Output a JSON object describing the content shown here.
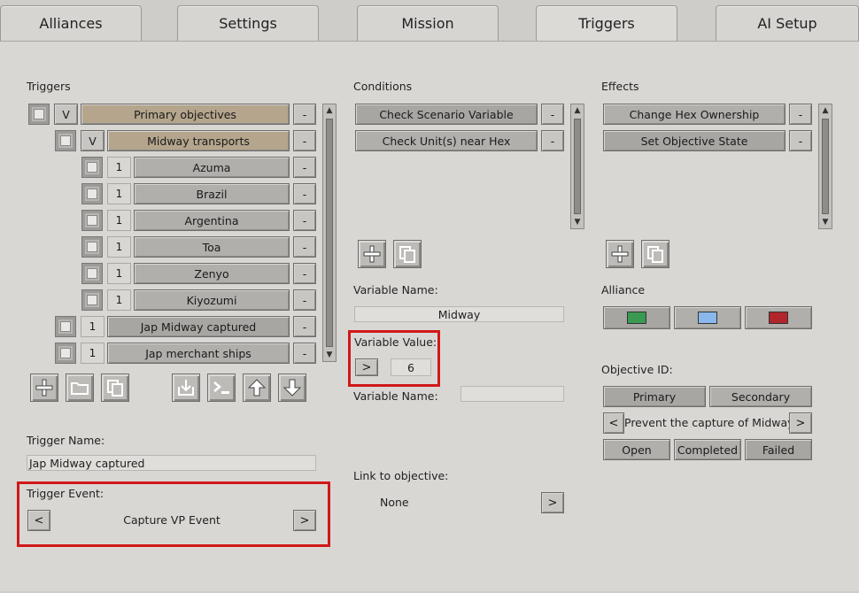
{
  "tabs": [
    "Alliances",
    "Settings",
    "Mission",
    "Triggers",
    "AI Setup"
  ],
  "triggers": {
    "title": "Triggers",
    "items": [
      {
        "flag": "V",
        "label": "Primary objectives"
      },
      {
        "flag": "V",
        "label": "Midway transports"
      },
      {
        "flag": "1",
        "label": "Azuma"
      },
      {
        "flag": "1",
        "label": "Brazil"
      },
      {
        "flag": "1",
        "label": "Argentina"
      },
      {
        "flag": "1",
        "label": "Toa"
      },
      {
        "flag": "1",
        "label": "Zenyo"
      },
      {
        "flag": "1",
        "label": "Kiyozumi"
      },
      {
        "flag": "1",
        "label": "Jap Midway captured"
      },
      {
        "flag": "1",
        "label": "Jap merchant ships"
      }
    ],
    "remove_label": "-",
    "name_label": "Trigger Name:",
    "name_value": "Jap Midway captured",
    "event_label": "Trigger Event:",
    "event_value": "Capture VP Event",
    "prev": "<",
    "next": ">"
  },
  "conditions": {
    "title": "Conditions",
    "items": [
      "Check Scenario Variable",
      "Check Unit(s) near Hex"
    ],
    "remove_label": "-",
    "var_name_label": "Variable Name:",
    "var_name_value": "Midway",
    "var_value_label": "Variable Value:",
    "var_value_op": ">",
    "var_value": "6",
    "var_name2_label": "Variable Name:",
    "var_name2_value": "",
    "link_label": "Link to objective:",
    "link_value": "None",
    "link_btn": ">"
  },
  "effects": {
    "title": "Effects",
    "items": [
      "Change Hex Ownership",
      "Set Objective State"
    ],
    "remove_label": "-",
    "alliance_label": "Alliance",
    "alliance_colors": [
      "#3a9a52",
      "#8ab8ec",
      "#b0262a"
    ],
    "objective_label": "Objective ID:",
    "primary": "Primary",
    "secondary": "Secondary",
    "objective_value": "Prevent the capture of Midway",
    "prev": "<",
    "next": ">",
    "states": [
      "Open",
      "Completed",
      "Failed"
    ]
  }
}
